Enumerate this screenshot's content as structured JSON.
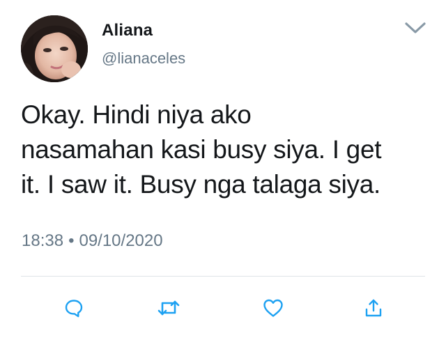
{
  "user": {
    "display_name": "Aliana",
    "handle": "@lianaceles",
    "avatar_icon": "profile-photo"
  },
  "tweet": {
    "text_lines": [
      "Okay. Hindi niya ako",
      "nasamahan kasi busy siya. I get",
      "it. I saw it. Busy nga talaga siya."
    ],
    "time": "18:38",
    "separator": "•",
    "date": "09/10/2020"
  },
  "header": {
    "menu_icon": "chevron-down-icon"
  },
  "actions": [
    {
      "name": "reply-button",
      "icon": "comment-icon"
    },
    {
      "name": "retweet-button",
      "icon": "retweet-icon"
    },
    {
      "name": "like-button",
      "icon": "heart-icon"
    },
    {
      "name": "share-button",
      "icon": "share-icon"
    }
  ],
  "colors": {
    "text": "#14171a",
    "secondary": "#657786",
    "icon": "#1da1f2",
    "divider": "#dfe3e7"
  }
}
